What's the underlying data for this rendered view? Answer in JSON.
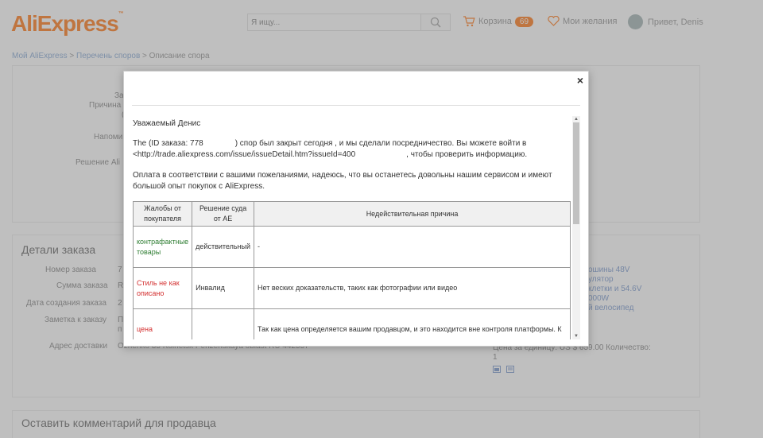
{
  "header": {
    "logo": "AliExpress",
    "logo_tm": "™",
    "search_placeholder": "Я ищу...",
    "cart_label": "Корзина",
    "cart_count": "69",
    "wishlist_label": "Мои желания",
    "greeting": "Привет, Denis"
  },
  "breadcrumb": {
    "item1": "Мой AliExpress",
    "sep": " > ",
    "item2": "Перечень споров",
    "item3": "Описание спора"
  },
  "background": {
    "panel1_labels": [
      "За",
      "Причина",
      "(",
      "Напоми",
      "Решение Ali"
    ],
    "order_details_title": "Детали заказа",
    "order_labels": [
      "Номер заказа",
      "Сумма заказа",
      "Дата создания заказа",
      "Заметка к заказу",
      "Адрес доставки"
    ],
    "order_values": [
      "7",
      "R",
      "2",
      "П",
      "Ozhenko 35 Kolnetsk Penzenskaya oblast RU 442557"
    ],
    "order_value_extra": "п",
    "right_links": [
      "ошины 48V",
      "улятор",
      "клетки и 54.6V",
      "000W",
      "й велосипед"
    ],
    "price_line": "Цена за единицу: US $ 659.00 Количество:",
    "quantity": "1",
    "comment_title": "Оставить комментарий для продавца"
  },
  "modal": {
    "close": "×",
    "greeting": "Уважаемый Денис",
    "para1_a": "The (ID заказа: 778",
    "para1_b": ") спор был закрыт сегодня , и мы сделали посредничество. Вы можете войти в",
    "para1_c": "<http://trade.aliexpress.com/issue/issueDetail.htm?issueId=400",
    "para1_d": ", чтобы проверить информацию.",
    "para2": "Оплата в соответствии с вашими пожеланиями, надеюсь, что вы останетесь довольны нашим сервисом и имеют большой опыт покупок с AliExpress.",
    "table": {
      "headers": [
        "Жалобы от покупателя",
        "Решение суда от AE",
        "Недействительная причина"
      ],
      "rows": [
        [
          "контрафактные товары",
          "действительный",
          "-"
        ],
        [
          "Стиль не как описано",
          "Инвалид",
          "Нет веских доказательств, таких как фотографии или видео"
        ],
        [
          "цена",
          "",
          "Так как цена определяется вашим продавцом, и это находится вне контроля платформы. К"
        ]
      ],
      "row_colors": [
        "#2e7d32",
        "#d32f2f",
        "#d32f2f"
      ]
    }
  }
}
